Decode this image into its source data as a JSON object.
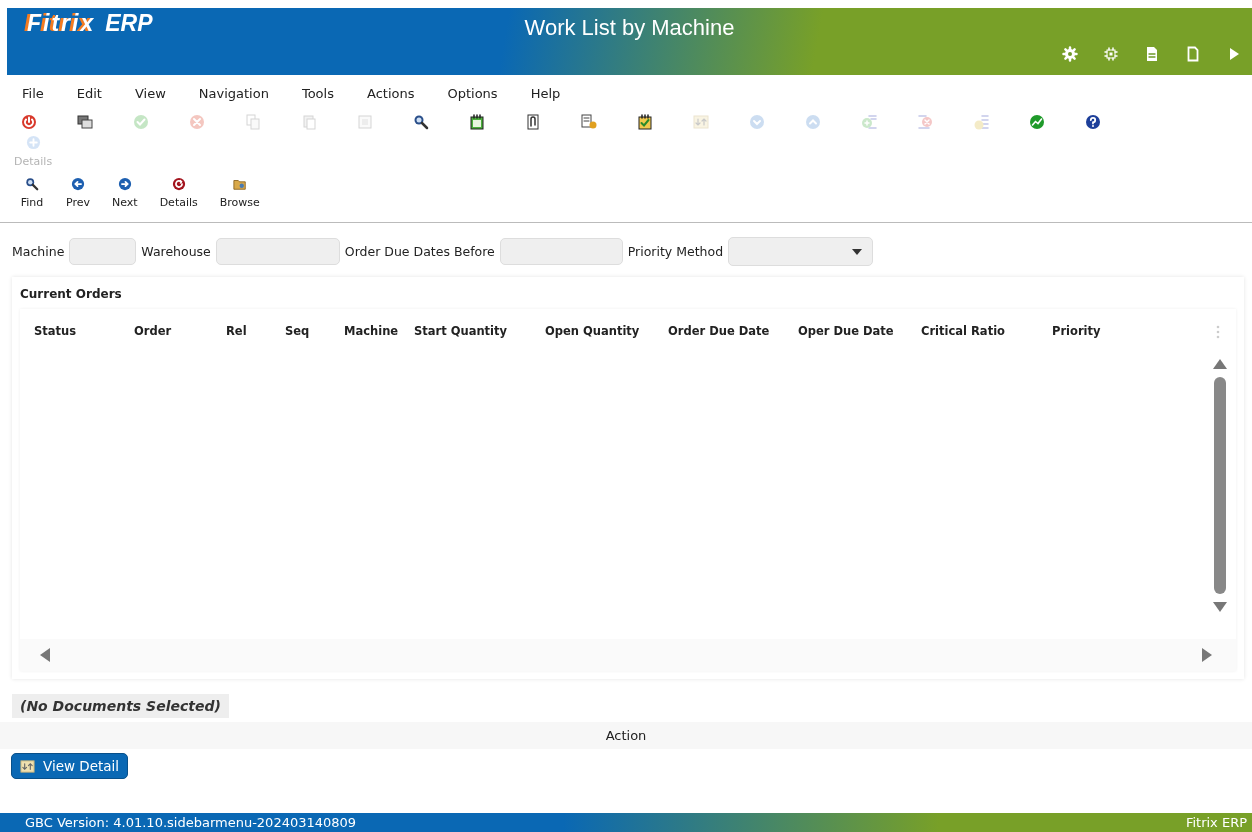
{
  "header": {
    "logo": {
      "brand": "Fitrix",
      "suffix": "ERP"
    },
    "title": "Work List by Machine",
    "icons": [
      {
        "kind": "gear"
      },
      {
        "kind": "chip"
      },
      {
        "kind": "doc-lines"
      },
      {
        "kind": "doc-blank"
      },
      {
        "kind": "play"
      }
    ]
  },
  "menu": [
    "File",
    "Edit",
    "View",
    "Navigation",
    "Tools",
    "Actions",
    "Options",
    "Help"
  ],
  "toolbar": [
    {
      "kind": "power",
      "disabled": false
    },
    {
      "kind": "windows",
      "disabled": false
    },
    {
      "kind": "check",
      "disabled": true
    },
    {
      "kind": "cancel",
      "disabled": true
    },
    {
      "kind": "copy",
      "disabled": true
    },
    {
      "kind": "paste",
      "disabled": true
    },
    {
      "kind": "select",
      "disabled": true
    },
    {
      "kind": "zoom",
      "disabled": false
    },
    {
      "kind": "notepad",
      "disabled": false
    },
    {
      "kind": "attach",
      "disabled": false
    },
    {
      "kind": "doc-person",
      "disabled": false
    },
    {
      "kind": "checklist",
      "disabled": false
    },
    {
      "kind": "swap",
      "disabled": true
    },
    {
      "kind": "down",
      "disabled": true
    },
    {
      "kind": "up",
      "disabled": true
    },
    {
      "kind": "add-row",
      "disabled": true
    },
    {
      "kind": "delete-row",
      "disabled": true
    },
    {
      "kind": "insert-row",
      "disabled": true
    },
    {
      "kind": "chart",
      "disabled": false
    },
    {
      "kind": "help",
      "disabled": false
    }
  ],
  "toolbar_labeled": [
    {
      "kind": "plus",
      "label": "Details",
      "disabled": true
    }
  ],
  "nav_buttons": [
    {
      "kind": "zoom",
      "label": "Find",
      "disabled": false
    },
    {
      "kind": "prev",
      "label": "Prev",
      "disabled": false
    },
    {
      "kind": "next",
      "label": "Next",
      "disabled": false
    },
    {
      "kind": "refresh",
      "label": "Details",
      "disabled": false
    },
    {
      "kind": "folder",
      "label": "Browse",
      "disabled": false
    }
  ],
  "filters": [
    {
      "label": "Machine",
      "kind": "text"
    },
    {
      "label": "Warehouse",
      "kind": "text"
    },
    {
      "label": "Order Due Dates Before",
      "kind": "text"
    },
    {
      "label": "Priority Method",
      "kind": "select"
    }
  ],
  "table": {
    "title": "Current Orders",
    "columns": [
      "Status",
      "Order",
      "Rel",
      "Seq",
      "Machine",
      "Start Quantity",
      "Open Quantity",
      "Order Due Date",
      "Oper Due Date",
      "Critical Ratio",
      "Priority"
    ]
  },
  "documents_label": "(No Documents Selected)",
  "action_bar": {
    "label": "Action"
  },
  "view_detail_button": "View Detail",
  "status_bar": {
    "version": "GBC Version: 4.01.10.sidebarmenu-202403140809",
    "product": "Fitrix ERP"
  }
}
